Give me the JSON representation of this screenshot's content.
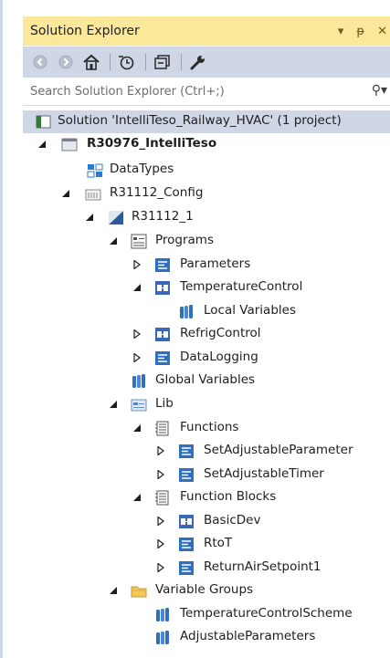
{
  "title": "Solution Explorer",
  "window_controls": [
    "▾",
    "ᵽ",
    "✕"
  ],
  "search": {
    "placeholder": "Search Solution Explorer (Ctrl+;)"
  },
  "tree": [
    {
      "label": "Solution 'IntelliTeso_Railway_HVAC' (1 project)",
      "icon": "solution-icon"
    },
    {
      "label": "R30976_IntelliTeso",
      "icon": "project-icon"
    },
    {
      "label": "DataTypes",
      "icon": "datatypes-icon"
    },
    {
      "label": "R31112_Config",
      "icon": "config-icon"
    },
    {
      "label": "R31112_1",
      "icon": "device-icon"
    },
    {
      "label": "Programs",
      "icon": "programs-icon"
    },
    {
      "label": "Parameters",
      "icon": "program-icon"
    },
    {
      "label": "TemperatureControl",
      "icon": "block-program-icon"
    },
    {
      "label": "Local Variables",
      "icon": "variables-icon"
    },
    {
      "label": "RefrigControl",
      "icon": "block-program-icon"
    },
    {
      "label": "DataLogging",
      "icon": "program-icon"
    },
    {
      "label": "Global Variables",
      "icon": "variables-icon"
    },
    {
      "label": "Lib",
      "icon": "lib-icon"
    },
    {
      "label": "Functions",
      "icon": "functions-icon"
    },
    {
      "label": "SetAdjustableParameter",
      "icon": "program-icon"
    },
    {
      "label": "SetAdjustableTimer",
      "icon": "program-icon"
    },
    {
      "label": "Function Blocks",
      "icon": "functions-icon"
    },
    {
      "label": "BasicDev",
      "icon": "block-program-icon"
    },
    {
      "label": "RtoT",
      "icon": "program-icon"
    },
    {
      "label": "ReturnAirSetpoint1",
      "icon": "program-icon"
    },
    {
      "label": "Variable Groups",
      "icon": "folder-icon"
    },
    {
      "label": "TemperatureControlScheme",
      "icon": "variables-icon"
    },
    {
      "label": "AdjustableParameters",
      "icon": "variables-icon"
    }
  ],
  "colors": {
    "title_bar": "#fbe89a",
    "toolbar": "#cfd6e5",
    "selected_row": "#cfd6e5"
  }
}
